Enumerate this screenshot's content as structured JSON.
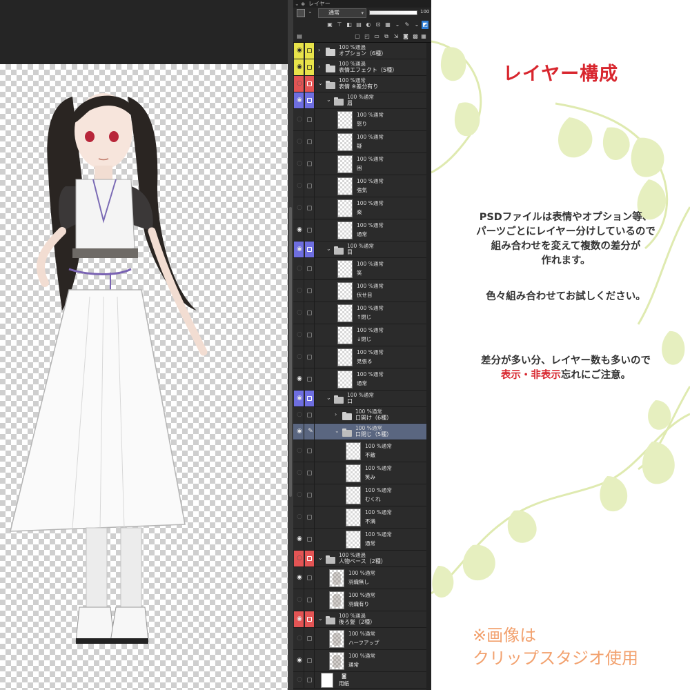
{
  "canvas": {},
  "layer_panel": {
    "title": "レイヤー",
    "blend_mode": "通常",
    "opacity_value": "100",
    "layers": [
      {
        "type": "folder",
        "depth": 0,
        "expanded": false,
        "label1": "100 %通過",
        "label2": "オプション（6種）",
        "visible": true,
        "color": "yellow"
      },
      {
        "type": "folder",
        "depth": 0,
        "expanded": false,
        "label1": "100 %通過",
        "label2": "表情エフェクト（5種）",
        "visible": true,
        "color": "yellow"
      },
      {
        "type": "folder",
        "depth": 0,
        "expanded": true,
        "label1": "100 %通常",
        "label2": "表情 ※差分有り",
        "visible": false,
        "color": "red"
      },
      {
        "type": "folder",
        "depth": 1,
        "expanded": true,
        "label1": "100 %通常",
        "label2": "眉",
        "visible": true,
        "color": "blue"
      },
      {
        "type": "layer",
        "depth": 2,
        "label1": "100 %通常",
        "label2": "怒り",
        "visible": false
      },
      {
        "type": "layer",
        "depth": 2,
        "label1": "100 %通常",
        "label2": "疑",
        "visible": false
      },
      {
        "type": "layer",
        "depth": 2,
        "label1": "100 %通常",
        "label2": "困",
        "visible": false
      },
      {
        "type": "layer",
        "depth": 2,
        "label1": "100 %通常",
        "label2": "強気",
        "visible": false
      },
      {
        "type": "layer",
        "depth": 2,
        "label1": "100 %通常",
        "label2": "楽",
        "visible": false
      },
      {
        "type": "layer",
        "depth": 2,
        "label1": "100 %通常",
        "label2": "通常",
        "visible": true
      },
      {
        "type": "folder",
        "depth": 1,
        "expanded": true,
        "label1": "100 %通常",
        "label2": "目",
        "visible": true,
        "color": "blue"
      },
      {
        "type": "layer",
        "depth": 2,
        "label1": "100 %通常",
        "label2": "笑",
        "visible": false
      },
      {
        "type": "layer",
        "depth": 2,
        "label1": "100 %通常",
        "label2": "伏せ目",
        "visible": false
      },
      {
        "type": "layer",
        "depth": 2,
        "label1": "100 %通常",
        "label2": "↑閉じ",
        "visible": false
      },
      {
        "type": "layer",
        "depth": 2,
        "label1": "100 %通常",
        "label2": "↓閉じ",
        "visible": false
      },
      {
        "type": "layer",
        "depth": 2,
        "label1": "100 %通常",
        "label2": "見張る",
        "visible": false
      },
      {
        "type": "layer",
        "depth": 2,
        "label1": "100 %通常",
        "label2": "通常",
        "visible": true
      },
      {
        "type": "folder",
        "depth": 1,
        "expanded": true,
        "label1": "100 %通常",
        "label2": "口",
        "visible": true,
        "color": "blue"
      },
      {
        "type": "folder",
        "depth": 2,
        "expanded": false,
        "label1": "100 %通常",
        "label2": "口開け（6種）",
        "visible": false
      },
      {
        "type": "folder",
        "depth": 2,
        "expanded": true,
        "label1": "100 %通常",
        "label2": "口閉じ（5種）",
        "visible": true,
        "selected": true,
        "pen": true
      },
      {
        "type": "layer",
        "depth": 3,
        "label1": "100 %通常",
        "label2": "不敵",
        "visible": false
      },
      {
        "type": "layer",
        "depth": 3,
        "label1": "100 %通常",
        "label2": "笑み",
        "visible": false
      },
      {
        "type": "layer",
        "depth": 3,
        "label1": "100 %通常",
        "label2": "むくれ",
        "visible": false
      },
      {
        "type": "layer",
        "depth": 3,
        "label1": "100 %通常",
        "label2": "不満",
        "visible": false
      },
      {
        "type": "layer",
        "depth": 3,
        "label1": "100 %通常",
        "label2": "通常",
        "visible": true
      },
      {
        "type": "folder",
        "depth": 0,
        "expanded": true,
        "label1": "100 %通過",
        "label2": "人物ベース（2種）",
        "visible": false,
        "color": "red"
      },
      {
        "type": "layer",
        "depth": 1,
        "label1": "100 %通常",
        "label2": "羽織無し",
        "visible": true,
        "drawn": true
      },
      {
        "type": "layer",
        "depth": 1,
        "label1": "100 %通常",
        "label2": "羽織有り",
        "visible": false,
        "drawn": true
      },
      {
        "type": "folder",
        "depth": 0,
        "expanded": true,
        "label1": "100 %通過",
        "label2": "後ろ髪（2種）",
        "visible": true,
        "color": "red"
      },
      {
        "type": "layer",
        "depth": 1,
        "label1": "100 %通常",
        "label2": "ハーフアップ",
        "visible": false,
        "drawn": true
      },
      {
        "type": "layer",
        "depth": 1,
        "label1": "100 %通常",
        "label2": "通常",
        "visible": true,
        "drawn": true
      },
      {
        "type": "paper",
        "depth": 0,
        "label1": "",
        "label2": "用紙",
        "visible": false
      }
    ]
  },
  "info": {
    "title": "レイヤー構成",
    "para1": [
      "PSDファイルは表情やオプション等、",
      "パーツごとにレイヤー分けしているので",
      "組み合わせを変えて複数の差分が",
      "作れます。"
    ],
    "para2": "色々組み合わせてお試しください。",
    "para3_line1": "差分が多い分、レイヤー数も多いので",
    "para3_red": "表示・非表示",
    "para3_rest": "忘れにご注意。",
    "footnote_line1": "※画像は",
    "footnote_line2": "クリップスタジオ使用",
    "colors": {
      "title": "#d8262e",
      "footnote": "#f2a16e",
      "ornament": "#dfeab0"
    }
  }
}
